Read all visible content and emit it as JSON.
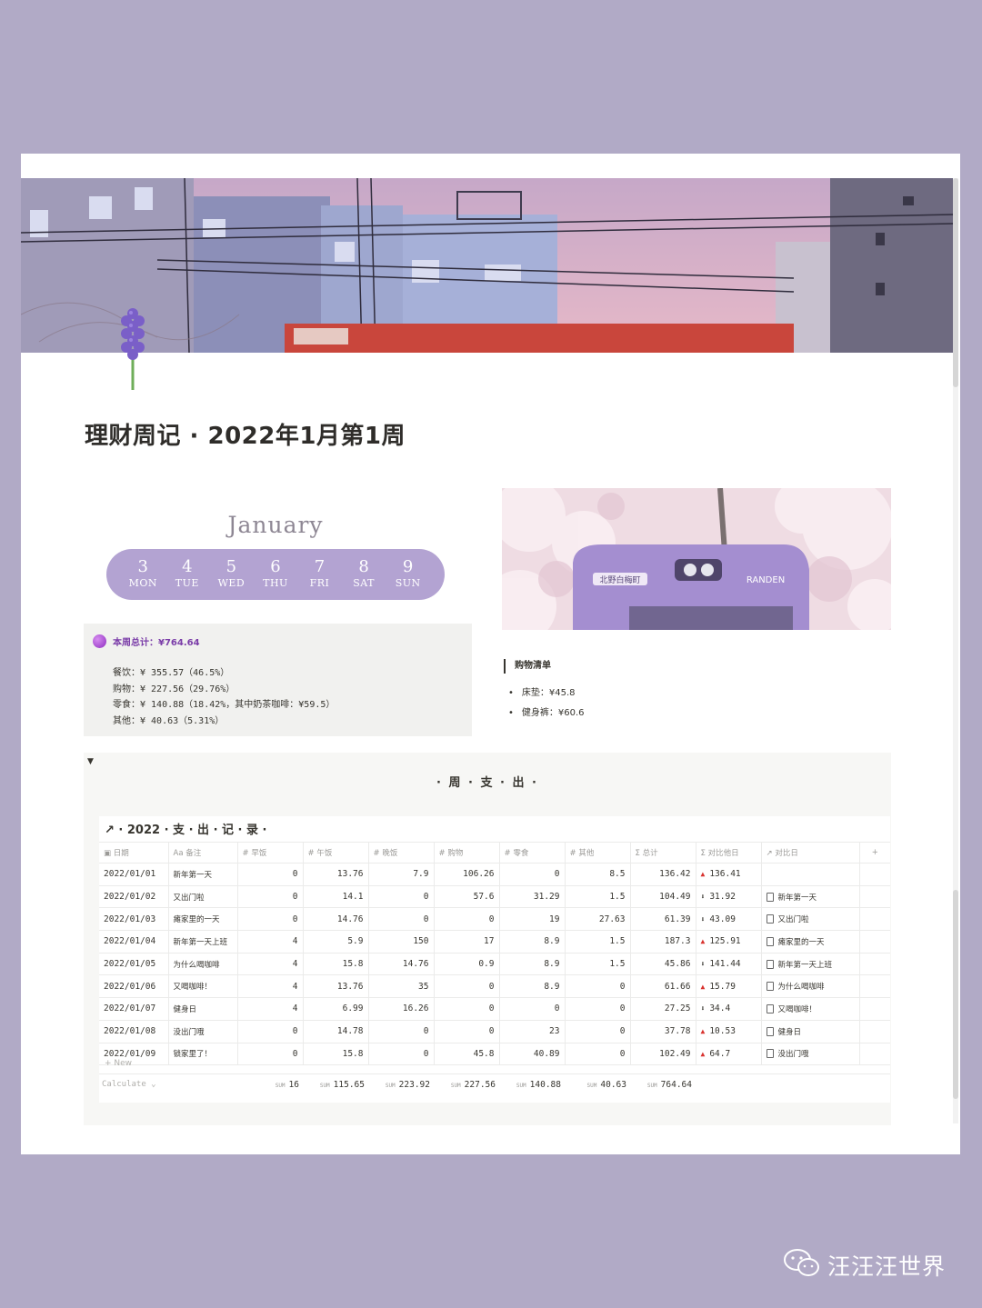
{
  "page": {
    "title": "理财周记 · 2022年1月第1周",
    "cover_image": "city-train-photo",
    "icon": "lavender-icon"
  },
  "calendar": {
    "month": "January",
    "days": [
      {
        "num": "3",
        "label": "MON"
      },
      {
        "num": "4",
        "label": "TUE"
      },
      {
        "num": "5",
        "label": "WED"
      },
      {
        "num": "6",
        "label": "THU"
      },
      {
        "num": "7",
        "label": "FRI"
      },
      {
        "num": "8",
        "label": "SAT"
      },
      {
        "num": "9",
        "label": "SUN"
      }
    ],
    "pill_color": "#b3a3d2"
  },
  "summary": {
    "heading": "本周总计：¥764.64",
    "lines": [
      "餐饮：¥ 355.57（46.5%）",
      "购物：¥ 227.56（29.76%）",
      "零食：¥ 140.88（18.42%，其中奶茶咖啡：¥59.5）",
      "其他：¥ 40.63（5.31%）"
    ]
  },
  "photo2": {
    "sign_text": "北野白梅町",
    "brand": "RANDEN"
  },
  "shopping": {
    "heading": "购物清单",
    "items": [
      "床垫：¥45.8",
      "健身裤：¥60.6"
    ]
  },
  "weekly": {
    "heading": "· 周 · 支 · 出 ·",
    "db_title": "↗ · 2022 · 支 · 出 · 记 · 录 ·",
    "columns": [
      "日期",
      "备注",
      "早饭",
      "午饭",
      "晚饭",
      "购物",
      "零食",
      "其他",
      "总计",
      "对比他日",
      "对比日",
      "+"
    ],
    "column_icons": [
      "▣",
      "Aa",
      "#",
      "#",
      "#",
      "#",
      "#",
      "#",
      "Σ",
      "Σ",
      "↗",
      ""
    ],
    "rows": [
      {
        "date": "2022/01/01",
        "note": "新年第一天",
        "breakfast": "0",
        "lunch": "13.76",
        "dinner": "7.9",
        "shopping": "106.26",
        "snack": "0",
        "other": "8.5",
        "total": "136.42",
        "dir": "up",
        "diff": "136.41",
        "compare": ""
      },
      {
        "date": "2022/01/02",
        "note": "又出门啦",
        "breakfast": "0",
        "lunch": "14.1",
        "dinner": "0",
        "shopping": "57.6",
        "snack": "31.29",
        "other": "1.5",
        "total": "104.49",
        "dir": "down",
        "diff": "31.92",
        "compare": "新年第一天"
      },
      {
        "date": "2022/01/03",
        "note": "瘫家里的一天",
        "breakfast": "0",
        "lunch": "14.76",
        "dinner": "0",
        "shopping": "0",
        "snack": "19",
        "other": "27.63",
        "total": "61.39",
        "dir": "down",
        "diff": "43.09",
        "compare": "又出门啦"
      },
      {
        "date": "2022/01/04",
        "note": "新年第一天上班",
        "breakfast": "4",
        "lunch": "5.9",
        "dinner": "150",
        "shopping": "17",
        "snack": "8.9",
        "other": "1.5",
        "total": "187.3",
        "dir": "up",
        "diff": "125.91",
        "compare": "瘫家里的一天"
      },
      {
        "date": "2022/01/05",
        "note": "为什么喝咖啡",
        "breakfast": "4",
        "lunch": "15.8",
        "dinner": "14.76",
        "shopping": "0.9",
        "snack": "8.9",
        "other": "1.5",
        "total": "45.86",
        "dir": "down",
        "diff": "141.44",
        "compare": "新年第一天上班"
      },
      {
        "date": "2022/01/06",
        "note": "又喝咖啡！",
        "breakfast": "4",
        "lunch": "13.76",
        "dinner": "35",
        "shopping": "0",
        "snack": "8.9",
        "other": "0",
        "total": "61.66",
        "dir": "up",
        "diff": "15.79",
        "compare": "为什么喝咖啡"
      },
      {
        "date": "2022/01/07",
        "note": "健身日",
        "breakfast": "4",
        "lunch": "6.99",
        "dinner": "16.26",
        "shopping": "0",
        "snack": "0",
        "other": "0",
        "total": "27.25",
        "dir": "down",
        "diff": "34.4",
        "compare": "又喝咖啡！"
      },
      {
        "date": "2022/01/08",
        "note": "没出门哦",
        "breakfast": "0",
        "lunch": "14.78",
        "dinner": "0",
        "shopping": "0",
        "snack": "23",
        "other": "0",
        "total": "37.78",
        "dir": "up",
        "diff": "10.53",
        "compare": "健身日"
      },
      {
        "date": "2022/01/09",
        "note": "锁家里了！",
        "breakfast": "0",
        "lunch": "15.8",
        "dinner": "0",
        "shopping": "45.8",
        "snack": "40.89",
        "other": "0",
        "total": "102.49",
        "dir": "up",
        "diff": "64.7",
        "compare": "没出门哦"
      }
    ],
    "new_label": "+ New",
    "calculate_label": "Calculate ⌄",
    "sum_key": "SUM",
    "sums": [
      "16",
      "115.65",
      "223.92",
      "227.56",
      "140.88",
      "40.63",
      "764.64"
    ],
    "colors": {
      "up": "#d8322e",
      "down": "#37352f"
    }
  },
  "watermark": {
    "text": "汪汪汪世界",
    "icon": "wechat-icon"
  }
}
